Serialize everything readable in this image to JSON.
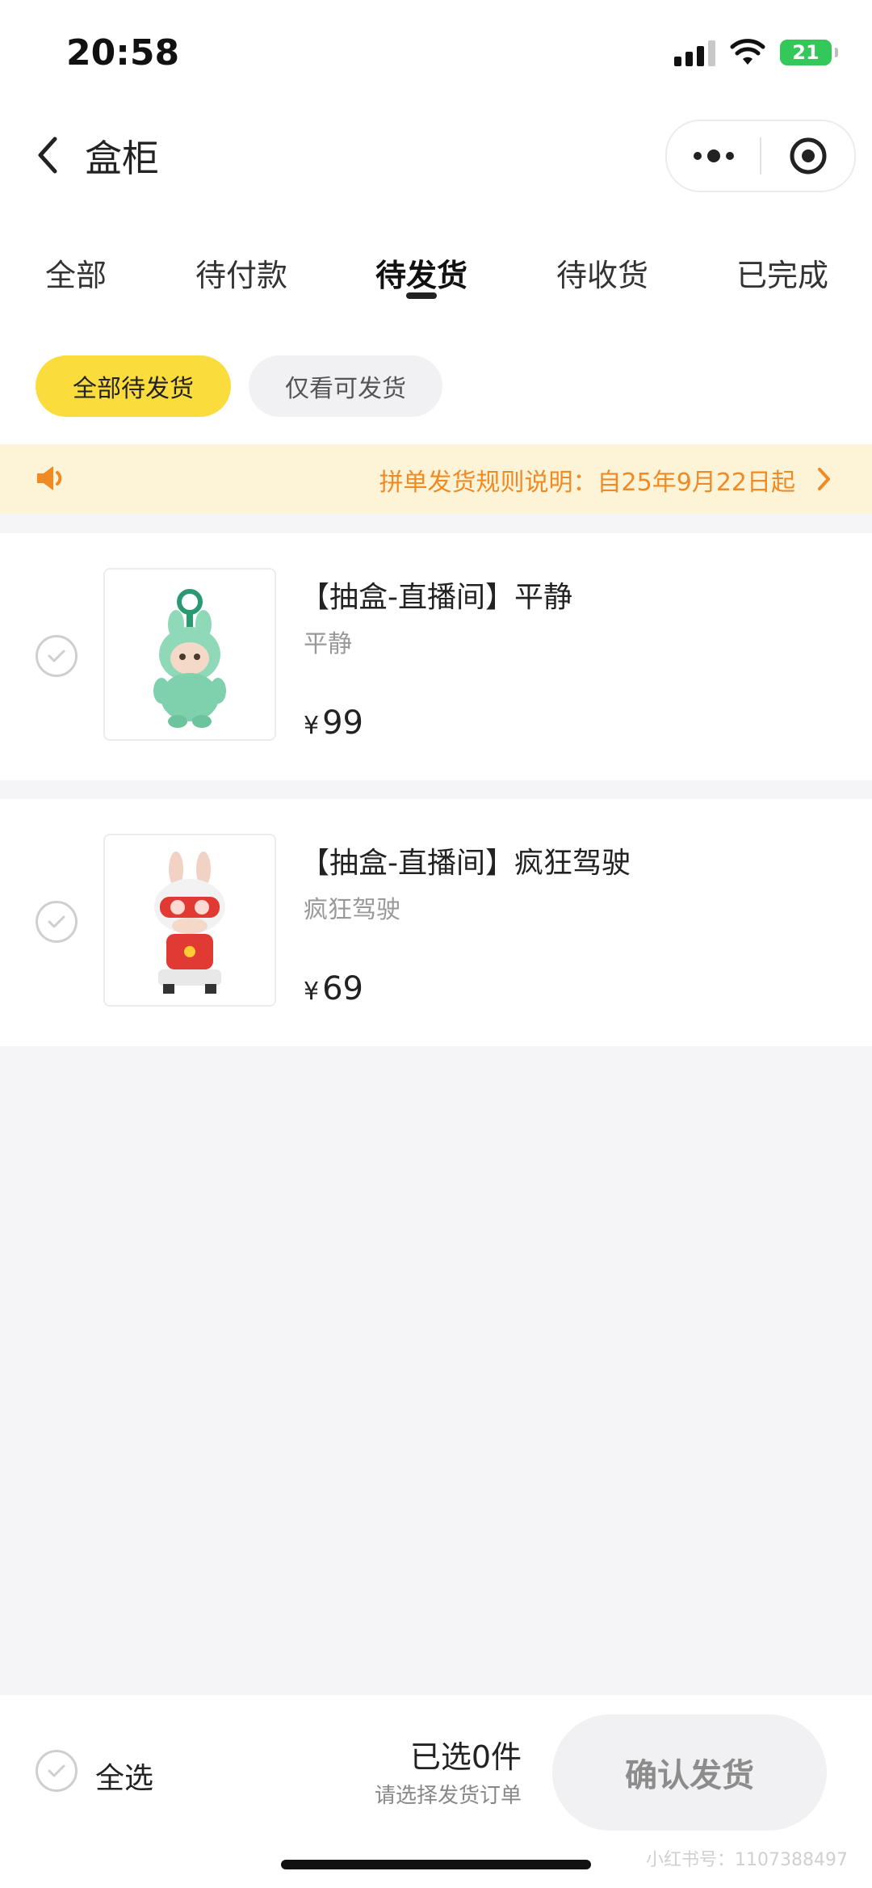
{
  "status_bar": {
    "time": "20:58",
    "battery": "21"
  },
  "header": {
    "title": "盒柜"
  },
  "tabs": [
    {
      "label": "全部"
    },
    {
      "label": "待付款"
    },
    {
      "label": "待发货"
    },
    {
      "label": "待收货"
    },
    {
      "label": "已完成"
    }
  ],
  "active_tab": "待发货",
  "filters": [
    {
      "label": "全部待发货",
      "selected": true
    },
    {
      "label": "仅看可发货",
      "selected": false
    }
  ],
  "notice": {
    "text": "拼单发货规则说明：自25年9月22日起"
  },
  "orders": [
    {
      "name": "【抽盒-直播间】平静",
      "spec": "平静",
      "currency": "¥",
      "price": "99"
    },
    {
      "name": "【抽盒-直播间】疯狂驾驶",
      "spec": "疯狂驾驶",
      "currency": "¥",
      "price": "69"
    }
  ],
  "bottom": {
    "select_all": "全选",
    "selected": "已选0件",
    "hint": "请选择发货订单",
    "confirm": "确认发货"
  },
  "watermark": "小红书号：1107388497",
  "colors": {
    "accent": "#fadd3c",
    "notice_text": "#f08a24",
    "notice_bg": "#fdf4d8"
  }
}
